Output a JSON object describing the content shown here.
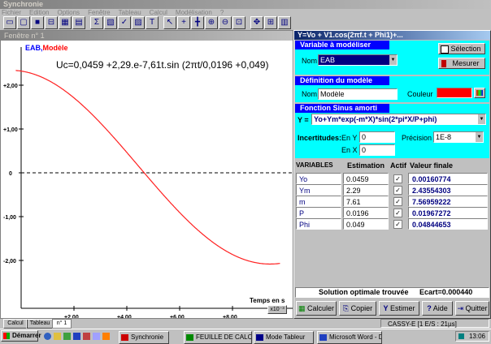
{
  "app": {
    "title": "Synchronie",
    "menu": [
      "Fichier",
      "Edition",
      "Options",
      "Fenêtre",
      "Tableau",
      "Calcul",
      "Modélisation",
      "?"
    ]
  },
  "graph_window": {
    "title": "Fenêtre n° 1",
    "legend_eab": "EAB,",
    "legend_model": "Modèle",
    "equation": "Uc=0,0459 +2,29.e-7,61t.sin (2πt/0,0196 +0,049)",
    "x_axis_title": "Temps en s",
    "x_scale": "x10⁻³",
    "y_ticks": [
      "+2,00",
      "+1,00",
      "0",
      "-1,00",
      "-2,00"
    ],
    "x_ticks": [
      "+2,00",
      "+4,00",
      "+6,00",
      "+8,00"
    ],
    "colors": {
      "eab": "#0000ff",
      "model": "#ff0000",
      "curve": "#ff2020"
    }
  },
  "model_dialog": {
    "title": "Y=Vo + V1.cos(2πf.t + Phi1)+...",
    "var_section": {
      "heading": "Variable à modéliser",
      "name_label": "Nom",
      "name_value": "EAB",
      "selection_button": "Sélection",
      "measure_button": "Mesurer"
    },
    "def_section": {
      "heading": "Définition du modèle",
      "name_label": "Nom",
      "name_value": "Modèle",
      "color_label": "Couleur",
      "color_value": "#ff0000"
    },
    "function_section": {
      "heading": "Fonction Sinus amorti",
      "y_label": "Y =",
      "formula": "Yo+Ym*exp(-m*X)*sin(2*pi*X/P+phi)",
      "uncertainties_label": "Incertitudes:",
      "en_y_label": "En Y",
      "en_y_value": "0",
      "en_x_label": "En X",
      "en_x_value": "0",
      "precision_label": "Précision",
      "precision_value": "1E-8"
    },
    "table": {
      "headers": [
        "VARIABLES",
        "Estimation",
        "Actif",
        "Valeur finale"
      ],
      "rows": [
        {
          "name": "Yo",
          "estimate": "0.0459",
          "active": true,
          "final": "0.00160774"
        },
        {
          "name": "Ym",
          "estimate": "2.29",
          "active": true,
          "final": "2.43554303"
        },
        {
          "name": "m",
          "estimate": "7.61",
          "active": true,
          "final": "7.56959222"
        },
        {
          "name": "P",
          "estimate": "0.0196",
          "active": true,
          "final": "0.01967272"
        },
        {
          "name": "Phi",
          "estimate": "0.049",
          "active": true,
          "final": "0.04844653"
        }
      ]
    },
    "status": {
      "solution": "Solution optimale trouvée",
      "error": "Ecart=0.000440"
    },
    "buttons": {
      "calculate": "Calculer",
      "copy": "Copier",
      "estimate": "Estimer",
      "help": "Aide",
      "quit": "Quitter"
    }
  },
  "bottom_tabs": [
    "Calcul",
    "Tableau",
    "n° 1"
  ],
  "status_bar": {
    "text": "CASSY-E [1 E/S : 21µs]"
  },
  "taskbar": {
    "start": "Démarrer",
    "tasks": [
      "Synchronie",
      "FEUILLE DE CALCUL",
      "Mode Tableur",
      "Microsoft Word - Do..."
    ],
    "clock": "13:06"
  }
}
